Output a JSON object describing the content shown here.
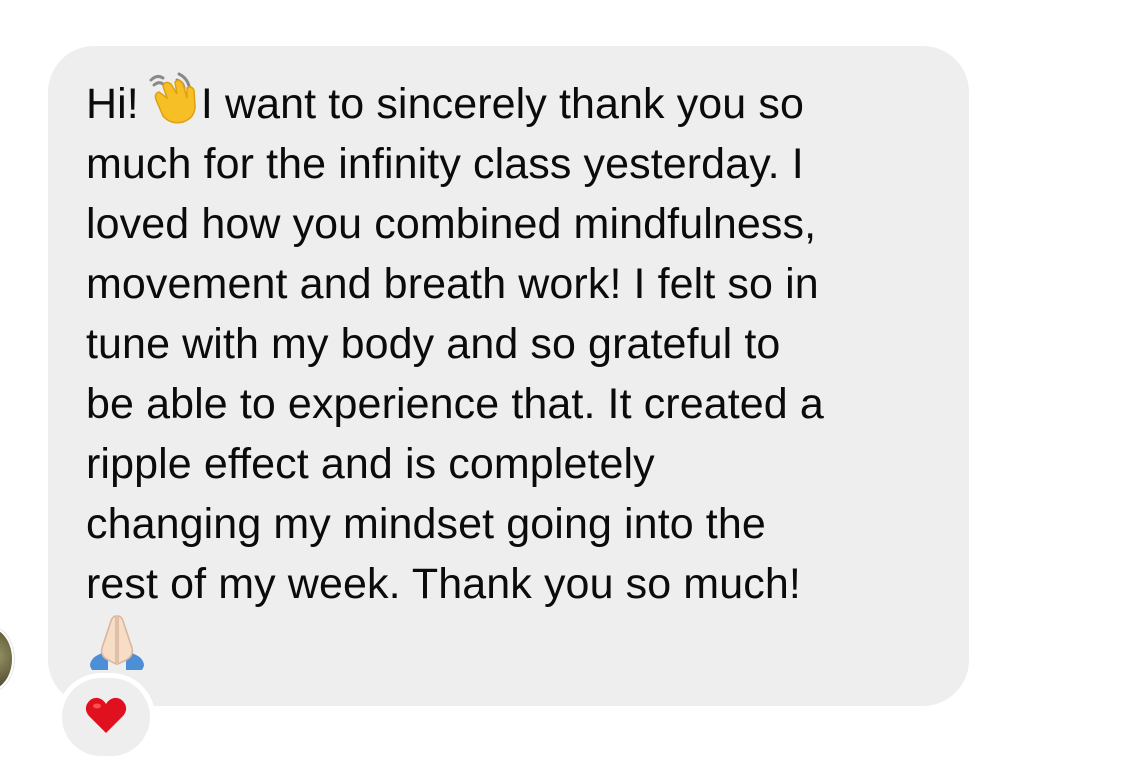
{
  "message": {
    "lines": [
      "Hi!",
      "I want to sincerely thank you so",
      "much for the infinity class yesterday. I",
      "loved how you combined mindfulness,",
      "movement and breath work! I felt so in",
      "tune with my body and so grateful to",
      "be able to experience that. It created a",
      "ripple effect and is completely",
      "changing my mindset going into the",
      "rest of my week. Thank you so much!"
    ],
    "inline_emoji": [
      "waving-hand-icon",
      "folded-hands-icon"
    ]
  },
  "reaction": {
    "icon": "red-heart-icon",
    "color": "#e0101e"
  },
  "colors": {
    "bubble": "#eeeeef",
    "text": "#0b0b0b",
    "background": "#ffffff"
  }
}
